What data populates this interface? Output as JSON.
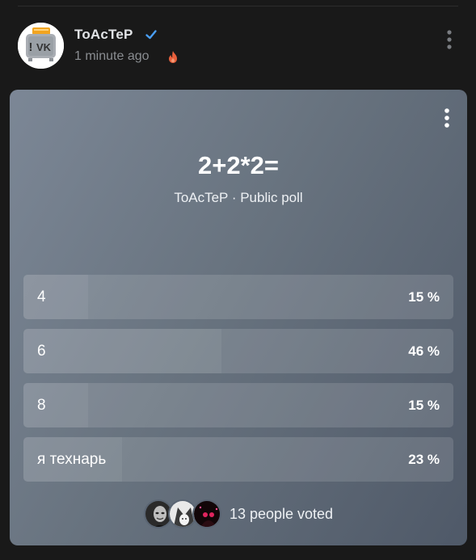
{
  "post": {
    "author": "ToAcTeP",
    "time": "1 minute ago",
    "verified": true,
    "avatar_icon": "toaster-vk-logo",
    "menu_icon": "more-vertical-icon"
  },
  "poll": {
    "question": "2+2*2=",
    "meta": "ToAcTeP · Public poll",
    "options": [
      {
        "label": "4",
        "percent_text": "15 %",
        "percent": 15
      },
      {
        "label": "6",
        "percent_text": "46 %",
        "percent": 46
      },
      {
        "label": "8",
        "percent_text": "15 %",
        "percent": 15
      },
      {
        "label": "я технарь",
        "percent_text": "23 %",
        "percent": 23
      }
    ],
    "voters_text": "13 people voted"
  },
  "colors": {
    "background": "#191919",
    "verified": "#4a9ff5",
    "fire": "#e8603c"
  }
}
